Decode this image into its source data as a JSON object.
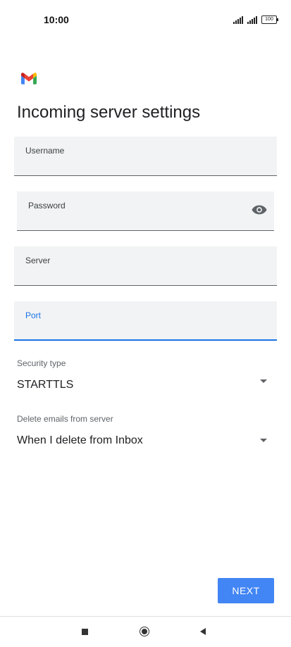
{
  "status_bar": {
    "time": "10:00",
    "battery": "100"
  },
  "page": {
    "title": "Incoming server settings"
  },
  "fields": {
    "username": {
      "label": "Username",
      "value": ""
    },
    "password": {
      "label": "Password",
      "value": ""
    },
    "server": {
      "label": "Server",
      "value": ""
    },
    "port": {
      "label": "Port",
      "value": ""
    }
  },
  "security_type": {
    "label": "Security type",
    "value": "STARTTLS"
  },
  "delete_emails": {
    "label": "Delete emails from server",
    "value": "When I delete from Inbox"
  },
  "actions": {
    "next_label": "NEXT"
  },
  "colors": {
    "accent": "#1a73e8",
    "button": "#4285f4",
    "field_bg": "#f1f3f4"
  },
  "icons": [
    "gmail-logo",
    "signal-icon",
    "battery-icon",
    "eye-icon",
    "chevron-down-icon",
    "nav-recents-icon",
    "nav-home-icon",
    "nav-back-icon"
  ]
}
